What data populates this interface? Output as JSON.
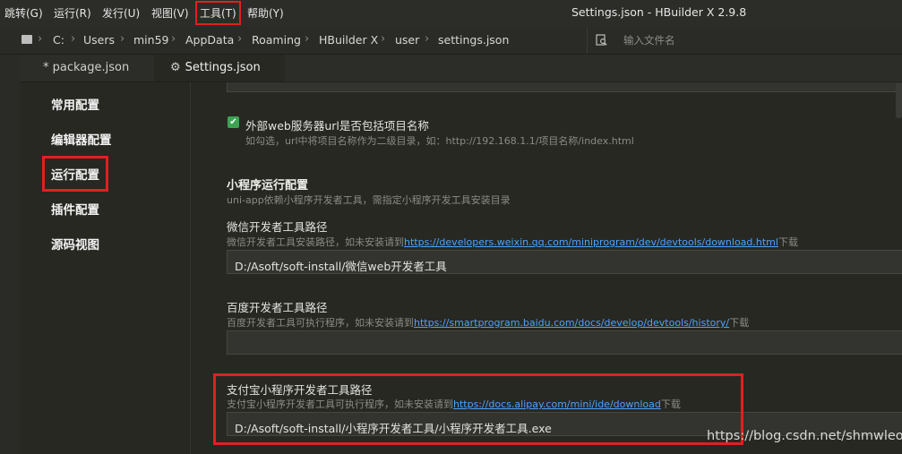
{
  "menu": {
    "items": [
      "跳转(G)",
      "运行(R)",
      "发行(U)",
      "视图(V)",
      "工具(T)",
      "帮助(Y)"
    ],
    "window_title": "Settings.json - HBuilder X 2.9.8"
  },
  "breadcrumb": [
    "C:",
    "Users",
    "min59",
    "AppData",
    "Roaming",
    "HBuilder X",
    "user",
    "settings.json"
  ],
  "file_search": {
    "placeholder": "输入文件名"
  },
  "tabs": [
    {
      "label": "* package.json"
    },
    {
      "label": "Settings.json"
    }
  ],
  "sidebar": {
    "items": [
      "常用配置",
      "编辑器配置",
      "运行配置",
      "插件配置",
      "源码视图"
    ]
  },
  "settings": {
    "web_server_option": {
      "label": "外部web服务器url是否包括项目名称",
      "hint": "如勾选，url中将项目名称作为二级目录，如：http://192.168.1.1/项目名称/index.html",
      "checked": true
    },
    "mini_section": {
      "heading": "小程序运行配置",
      "hint": "uni-app依赖小程序开发者工具，需指定小程序开发工具安装目录"
    },
    "wechat": {
      "label": "微信开发者工具路径",
      "hint_prefix": "微信开发者工具安装路径，如未安装请到",
      "link": "https://developers.weixin.qq.com/miniprogram/dev/devtools/download.html",
      "hint_suffix": "下载",
      "value": "D:/Asoft/soft-install/微信web开发者工具"
    },
    "baidu": {
      "label": "百度开发者工具路径",
      "hint_prefix": "百度开发者工具可执行程序，如未安装请到",
      "link": "https://smartprogram.baidu.com/docs/develop/devtools/history/",
      "hint_suffix": "下载",
      "value": ""
    },
    "alipay": {
      "label": "支付宝小程序开发者工具路径",
      "hint_prefix": "支付宝小程序开发者工具可执行程序，如未安装请到",
      "link": "https://docs.alipay.com/mini/ide/download",
      "hint_suffix": "下载",
      "value": "D:/Asoft/soft-install/小程序开发者工具/小程序开发者工具.exe"
    }
  },
  "watermark": "https://blog.csdn.net/shmwleo",
  "colors": {
    "accent_link": "#4ea1ff",
    "highlight_red": "#e02020",
    "check_green": "#3ea352",
    "background": "#272822"
  }
}
